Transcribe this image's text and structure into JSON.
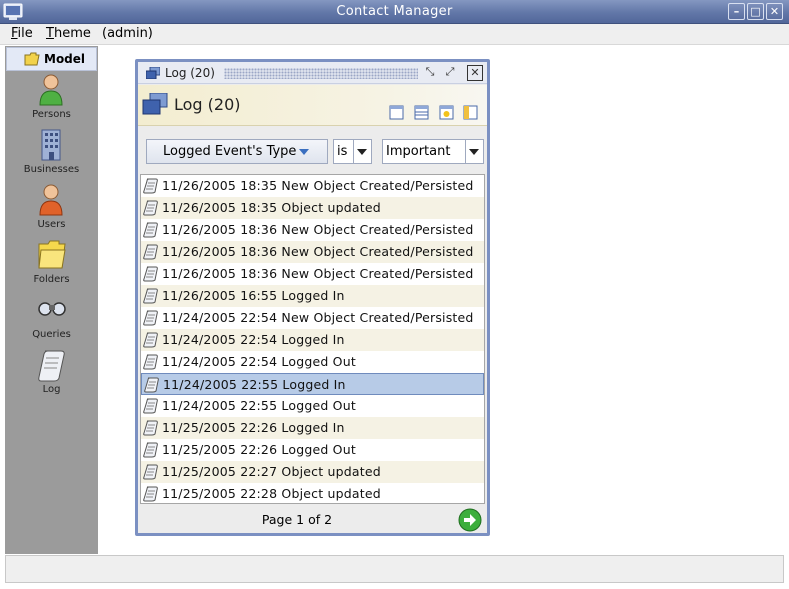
{
  "window": {
    "title": "Contact Manager"
  },
  "menu": {
    "file": "File",
    "file_mn": "F",
    "file_rest": "ile",
    "theme_mn": "T",
    "theme_rest": "heme",
    "user": "(admin)"
  },
  "outlook": {
    "group": "Model",
    "items": [
      {
        "label": "Persons",
        "icon": "person-icon"
      },
      {
        "label": "Businesses",
        "icon": "building-icon"
      },
      {
        "label": "Users",
        "icon": "user-icon"
      },
      {
        "label": "Folders",
        "icon": "folder-icon"
      },
      {
        "label": "Queries",
        "icon": "binoculars-icon"
      },
      {
        "label": "Log",
        "icon": "scroll-icon"
      }
    ]
  },
  "frame": {
    "title": "Log (20)",
    "header": "Log (20)",
    "filter": {
      "field": "Logged Event's Type",
      "operator": "is",
      "value": "Important"
    },
    "rows": [
      "11/26/2005 18:35 New Object Created/Persisted",
      "11/26/2005 18:35 Object updated",
      "11/26/2005 18:36 New Object Created/Persisted",
      "11/26/2005 18:36 New Object Created/Persisted",
      "11/26/2005 18:36 New Object Created/Persisted",
      "11/26/2005 16:55 Logged In",
      "11/24/2005 22:54 New Object Created/Persisted",
      "11/24/2005 22:54 Logged In",
      "11/24/2005 22:54 Logged Out",
      "11/24/2005 22:55 Logged In",
      "11/24/2005 22:55 Logged Out",
      "11/25/2005 22:26 Logged In",
      "11/25/2005 22:26 Logged Out",
      "11/25/2005 22:27 Object updated",
      "11/25/2005 22:28 Object updated"
    ],
    "selected_row": 9,
    "pager": "Page 1 of 2"
  },
  "colors": {
    "titlebar": "#6277a8",
    "selection": "#b7cbe7",
    "alt_row": "#f5f2e4",
    "frame_border": "#7b90c2"
  }
}
